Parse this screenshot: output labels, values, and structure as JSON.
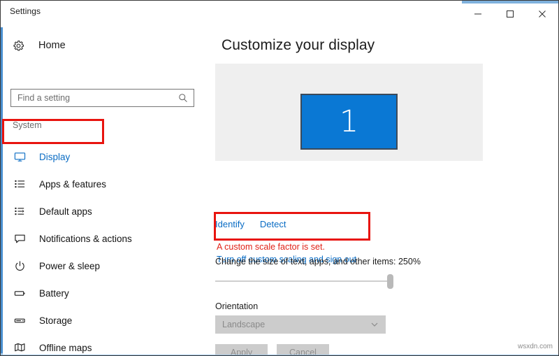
{
  "window": {
    "title": "Settings",
    "controls": {
      "minimize": "minimize-button",
      "maximize": "maximize-button",
      "close": "close-button"
    }
  },
  "sidebar": {
    "home_label": "Home",
    "home_icon": "gear-icon",
    "search": {
      "placeholder": "Find a setting",
      "value": "",
      "icon": "search-icon"
    },
    "section_label": "System",
    "items": [
      {
        "label": "Display",
        "icon": "monitor-icon",
        "active": true
      },
      {
        "label": "Apps & features",
        "icon": "list-icon",
        "active": false
      },
      {
        "label": "Default apps",
        "icon": "default-apps-icon",
        "active": false
      },
      {
        "label": "Notifications & actions",
        "icon": "speech-bubble-icon",
        "active": false
      },
      {
        "label": "Power & sleep",
        "icon": "power-icon",
        "active": false
      },
      {
        "label": "Battery",
        "icon": "battery-icon",
        "active": false
      },
      {
        "label": "Storage",
        "icon": "storage-icon",
        "active": false
      },
      {
        "label": "Offline maps",
        "icon": "map-icon",
        "active": false
      }
    ]
  },
  "main": {
    "page_title": "Customize your display",
    "preview": {
      "monitor_number": "1"
    },
    "links": [
      {
        "label": "Identify"
      },
      {
        "label": "Detect"
      }
    ],
    "warning": {
      "message": "A custom scale factor is set.",
      "link": "Turn off custom scaling and sign out"
    },
    "scale": {
      "label": "Change the size of text, apps, and other items: 250%",
      "value": "250%",
      "slider_position_percent": 96
    },
    "orientation": {
      "label": "Orientation",
      "value": "Landscape",
      "chevron": "chevron-down-icon",
      "disabled": true
    },
    "buttons": [
      {
        "label": "Apply"
      },
      {
        "label": "Cancel"
      }
    ]
  },
  "watermark": "wsxdn.com",
  "colors": {
    "accent_blue": "#0a6cc4",
    "monitor_blue": "#0a78d4",
    "annotation_red": "#e8140f",
    "warning_red": "#e02318",
    "panel_gray": "#efefef",
    "disabled_gray": "#cccccc"
  }
}
